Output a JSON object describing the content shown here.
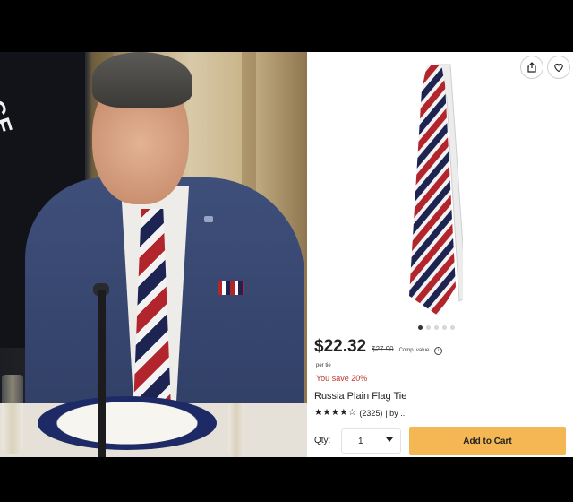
{
  "photo": {
    "flag_text": "RCE"
  },
  "product": {
    "gallery": {
      "total_images": 5,
      "active_index": 0
    },
    "price": "$22.32",
    "original_price": "$27.90",
    "comp_value_label": "Comp. value",
    "per_unit": "per tie",
    "savings": "You save 20%",
    "title": "Russia Plain Flag Tie",
    "rating_stars": 4.5,
    "rating_stars_text": "★★★★☆",
    "review_count": "(2325)",
    "by_label": "| by ...",
    "qty_label": "Qty:",
    "qty_value": "1",
    "add_to_cart_label": "Add to Cart",
    "colors": {
      "cart_button": "#f4b754",
      "savings": "#c0362c",
      "tie_red": "#b3252c",
      "tie_blue": "#1d2452",
      "tie_white": "#f2f2f2"
    },
    "icons": {
      "share": "share-icon",
      "favorite": "heart-icon",
      "info": "info-icon",
      "dropdown": "chevron-down-icon"
    }
  }
}
